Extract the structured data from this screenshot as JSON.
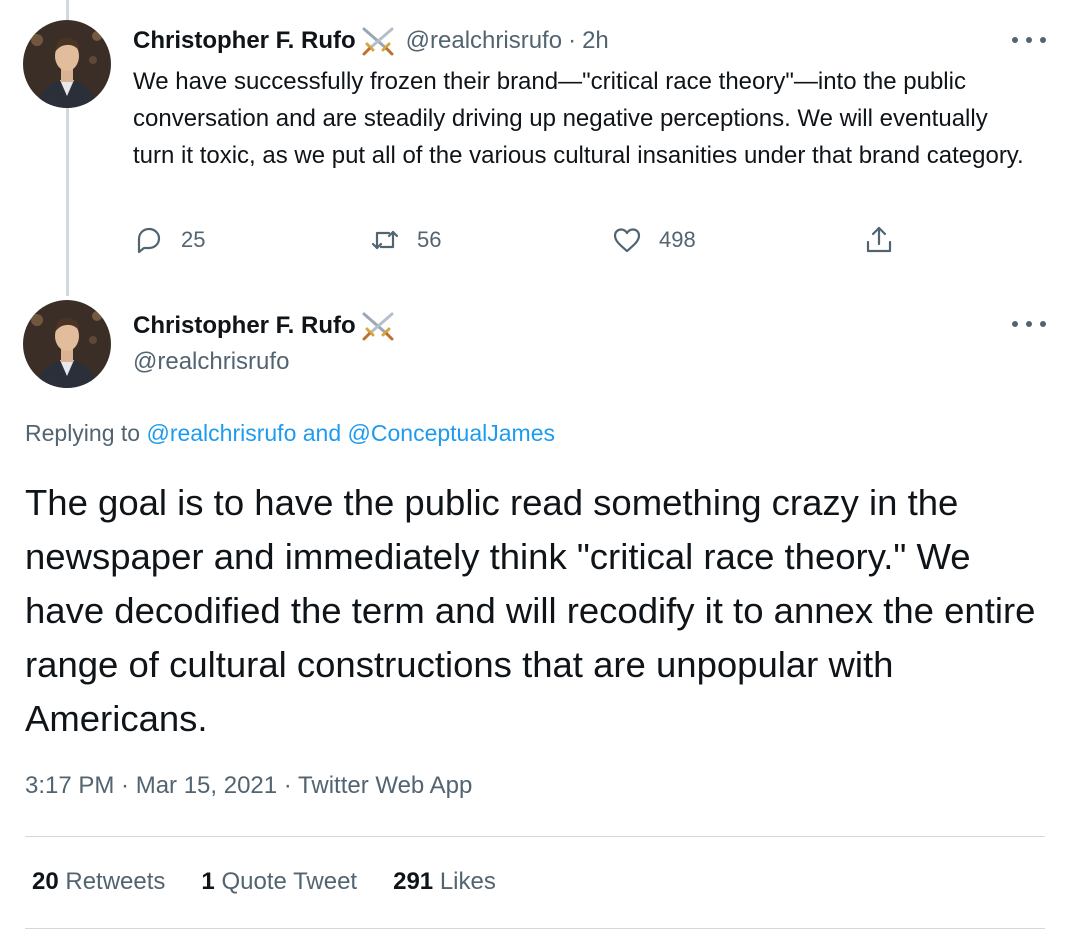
{
  "first_tweet": {
    "display_name": "Christopher F. Rufo",
    "handle": "@realchrisrufo",
    "separator": "·",
    "time_ago": "2h",
    "text": "We have successfully frozen their brand—\"critical race theory\"—into the public conversation and are steadily driving up negative perceptions. We will eventually turn it toxic, as we put all of the various cultural insanities under that brand category.",
    "replies": "25",
    "retweets": "56",
    "likes": "498"
  },
  "main_tweet": {
    "display_name": "Christopher F. Rufo",
    "handle": "@realchrisrufo",
    "replying_prefix": "Replying to",
    "reply_mention_1": "@realchrisrufo",
    "reply_conjunction": "and",
    "reply_mention_2": "@ConceptualJames",
    "text": "The goal is to have the public read something crazy in the newspaper and immediately think \"critical race theory.\" We have decodified the term and will recodify it to annex the entire range of cultural constructions that are unpopular with Americans.",
    "timestamp": "3:17 PM · Mar 15, 2021 · Twitter Web App",
    "retweet_count": "20",
    "retweet_label": "Retweets",
    "quote_count": "1",
    "quote_label": "Quote Tweet",
    "like_count": "291",
    "like_label": "Likes"
  },
  "icons": {
    "badge": "crossed-swords-icon",
    "reply": "reply-icon",
    "retweet": "retweet-icon",
    "like": "heart-icon",
    "share": "share-icon",
    "more": "more-icon"
  },
  "colors": {
    "link": "#1d9bf0",
    "secondary_text": "#536471",
    "primary_text": "#0f1419",
    "divider": "#cfd9de"
  }
}
